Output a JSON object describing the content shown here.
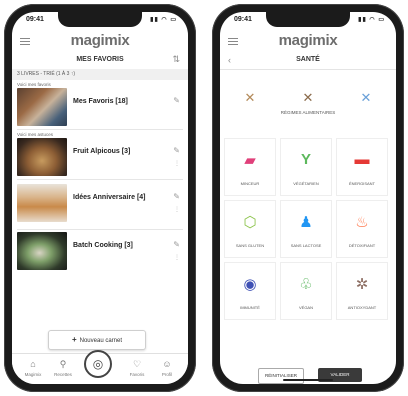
{
  "app": {
    "brand": "magimix"
  },
  "left": {
    "status": {
      "time": "09:41",
      "icons": "▮▮ ◠ ▭"
    },
    "page_title": "MES FAVORIS",
    "filter": "3 LIVRES - TRIÉ (1 À 3 ↑)",
    "books": [
      {
        "tag": "Voici mes favoris",
        "title": "Mes Favoris [18]"
      },
      {
        "tag": "Voici mes astuces",
        "title": "Fruit Alpicous [3]"
      },
      {
        "tag": "",
        "title": "Idées Anniversaire [4]"
      },
      {
        "tag": "",
        "title": "Batch Cooking [3]"
      }
    ],
    "new_button": "Nouveau carnet",
    "tabs": [
      {
        "label": "Magimix",
        "icon": "home-icon"
      },
      {
        "label": "Recettes",
        "icon": "search-icon"
      },
      {
        "label": "Favoris",
        "icon": "heart-icon"
      },
      {
        "label": "Profil",
        "icon": "user-icon"
      }
    ]
  },
  "right": {
    "status": {
      "time": "09:41",
      "icons": "▮▮ ◠ ▭"
    },
    "page_title": "SANTÉ",
    "allergy_label": "RÉGIMES ALIMENTAIRES",
    "allergies": [
      {
        "icon": "no-wheat-icon",
        "glyph": "✕"
      },
      {
        "icon": "no-dairy-icon",
        "glyph": "✕"
      },
      {
        "icon": "no-fish-icon",
        "glyph": "✕"
      }
    ],
    "cells": [
      {
        "label": "MINCEUR",
        "icon": "scale-icon",
        "glyph": "▰",
        "color": "#e0407a"
      },
      {
        "label": "VÉGÉTARIEN",
        "icon": "sprout-icon",
        "glyph": "Y",
        "color": "#5cb85c"
      },
      {
        "label": "ÉNERGISANT",
        "icon": "battery-icon",
        "glyph": "▬",
        "color": "#e53935"
      },
      {
        "label": "SANS GLUTEN",
        "icon": "leaf-icon",
        "glyph": "⬡",
        "color": "#8bc34a"
      },
      {
        "label": "SANS LACTOSE",
        "icon": "bottle-icon",
        "glyph": "♟",
        "color": "#2196f3"
      },
      {
        "label": "DÉTOXIFIANT",
        "icon": "sink-icon",
        "glyph": "♨",
        "color": "#ff7043"
      },
      {
        "label": "IMMUNITÉ",
        "icon": "shield-icon",
        "glyph": "◉",
        "color": "#3f51b5"
      },
      {
        "label": "VÉGAN",
        "icon": "vegan-icon",
        "glyph": "♧",
        "color": "#4caf50"
      },
      {
        "label": "ANTIOXYDANT",
        "icon": "grape-icon",
        "glyph": "✲",
        "color": "#8d6e63"
      }
    ],
    "reset_button": "RÉINITIALISER",
    "validate_button": "VALIDER"
  }
}
